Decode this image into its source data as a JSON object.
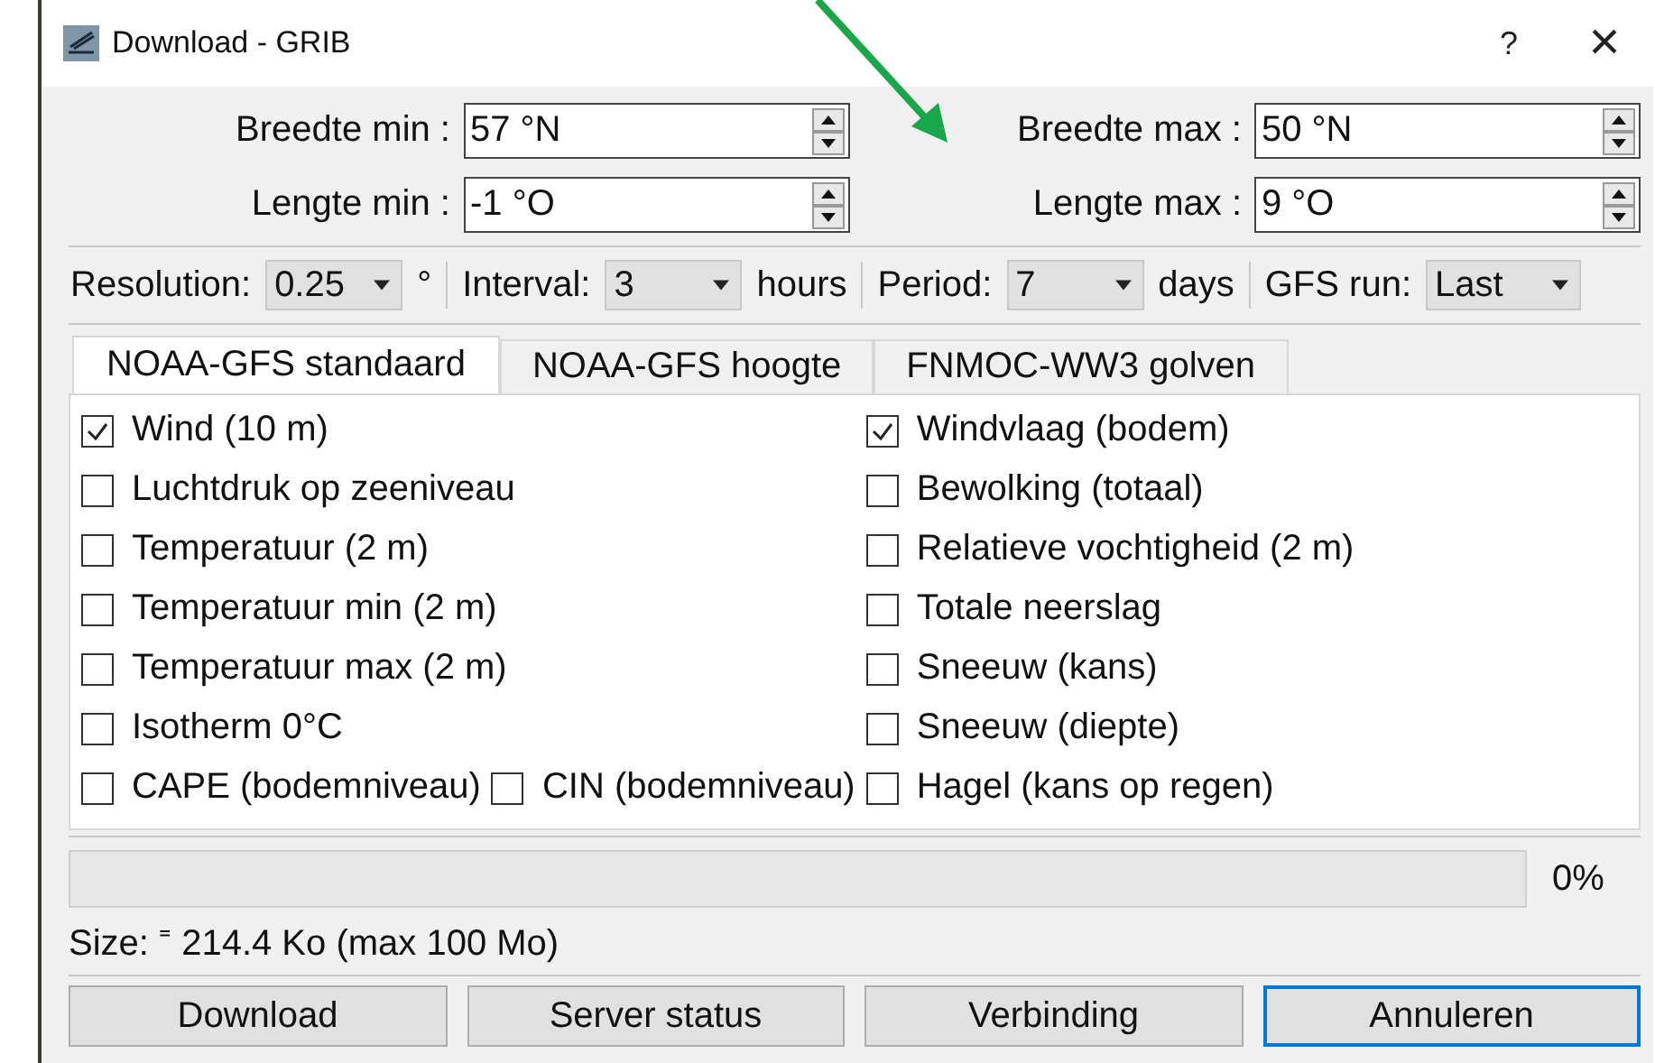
{
  "window": {
    "title": "Download - GRIB",
    "help": "?",
    "close": "×"
  },
  "area_fields": [
    {
      "label": "Breedte min :",
      "value": "57 °N"
    },
    {
      "label": "Breedte max :",
      "value": "50 °N"
    },
    {
      "label": "Lengte min :",
      "value": "-1 °O"
    },
    {
      "label": "Lengte max :",
      "value": "9 °O"
    }
  ],
  "settings": [
    {
      "label": "Resolution:",
      "value": "0.25",
      "unit": "°"
    },
    {
      "label": "Interval:",
      "value": "3",
      "unit": "hours"
    },
    {
      "label": "Period:",
      "value": "7",
      "unit": "days"
    },
    {
      "label": "GFS run:",
      "value": "Last"
    }
  ],
  "tabs": [
    {
      "label": "NOAA-GFS standaard",
      "selected": true
    },
    {
      "label": "NOAA-GFS hoogte",
      "selected": false
    },
    {
      "label": "FNMOC-WW3 golven",
      "selected": false
    }
  ],
  "option_rows": [
    {
      "left": {
        "label": "Wind (10 m)",
        "checked": true
      },
      "right": {
        "label": "Windvlaag (bodem)",
        "checked": true
      }
    },
    {
      "left": {
        "label": "Luchtdruk op zeeniveau",
        "checked": false
      },
      "right": {
        "label": "Bewolking (totaal)",
        "checked": false
      }
    },
    {
      "left": {
        "label": "Temperatuur (2 m)",
        "checked": false
      },
      "right": {
        "label": "Relatieve vochtigheid (2 m)",
        "checked": false
      }
    },
    {
      "left": {
        "label": "Temperatuur min (2 m)",
        "checked": false
      },
      "right": {
        "label": "Totale neerslag",
        "checked": false
      }
    },
    {
      "left": {
        "label": "Temperatuur max (2 m)",
        "checked": false
      },
      "right": {
        "label": "Sneeuw (kans)",
        "checked": false
      }
    },
    {
      "left": {
        "label": "Isotherm 0°C",
        "checked": false
      },
      "right": {
        "label": "Sneeuw (diepte)",
        "checked": false
      }
    },
    {
      "left": {
        "label": "CAPE (bodemniveau)",
        "checked": false
      },
      "middle": {
        "label": "CIN (bodemniveau)",
        "checked": false
      },
      "right": {
        "label": "Hagel (kans op regen)",
        "checked": false
      }
    }
  ],
  "progress": {
    "level": 0,
    "reading": "0%"
  },
  "size_text": "Size: ⁼ 214.4 Ko (max 100 Mo)",
  "buttons": [
    {
      "label": "Download",
      "selected": false
    },
    {
      "label": "Server status",
      "selected": false
    },
    {
      "label": "Verbinding",
      "selected": false
    },
    {
      "label": "Annuleren",
      "selected": true
    }
  ]
}
